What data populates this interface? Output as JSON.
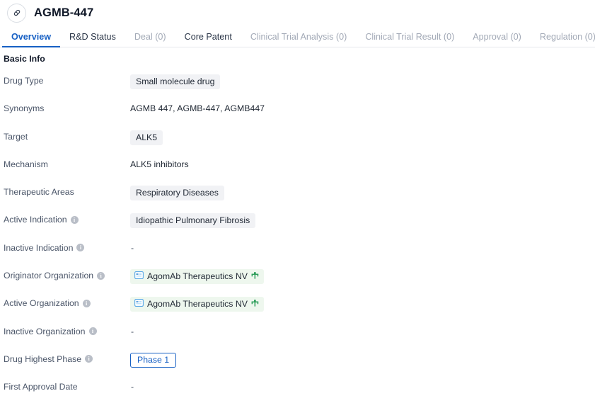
{
  "header": {
    "drug_name": "AGMB-447",
    "avatar_icon": "capsule-pill-icon"
  },
  "tabs": [
    {
      "label": "Overview",
      "state": "active"
    },
    {
      "label": "R&D Status",
      "state": "enabled"
    },
    {
      "label": "Deal (0)",
      "state": "disabled"
    },
    {
      "label": "Core Patent",
      "state": "enabled"
    },
    {
      "label": "Clinical Trial Analysis (0)",
      "state": "disabled"
    },
    {
      "label": "Clinical Trial Result (0)",
      "state": "disabled"
    },
    {
      "label": "Approval (0)",
      "state": "disabled"
    },
    {
      "label": "Regulation (0)",
      "state": "disabled"
    }
  ],
  "section": {
    "title": "Basic Info"
  },
  "rows": [
    {
      "label": "Drug Type",
      "has_info": false,
      "value_type": "chip",
      "value": "Small molecule drug"
    },
    {
      "label": "Synonyms",
      "has_info": false,
      "value_type": "text",
      "value": "AGMB 447,  AGMB-447,  AGMB447"
    },
    {
      "label": "Target",
      "has_info": false,
      "value_type": "chip",
      "value": "ALK5"
    },
    {
      "label": "Mechanism",
      "has_info": false,
      "value_type": "text",
      "value": "ALK5 inhibitors"
    },
    {
      "label": "Therapeutic Areas",
      "has_info": false,
      "value_type": "chip",
      "value": "Respiratory Diseases"
    },
    {
      "label": "Active Indication",
      "has_info": true,
      "value_type": "chip",
      "value": "Idiopathic Pulmonary Fibrosis"
    },
    {
      "label": "Inactive Indication",
      "has_info": true,
      "value_type": "empty",
      "value": "-"
    },
    {
      "label": "Originator Organization",
      "has_info": true,
      "value_type": "org",
      "value": "AgomAb Therapeutics NV"
    },
    {
      "label": "Active Organization",
      "has_info": true,
      "value_type": "org",
      "value": "AgomAb Therapeutics NV"
    },
    {
      "label": "Inactive Organization",
      "has_info": true,
      "value_type": "empty",
      "value": "-"
    },
    {
      "label": "Drug Highest Phase",
      "has_info": true,
      "value_type": "phase",
      "value": "Phase 1"
    },
    {
      "label": "First Approval Date",
      "has_info": false,
      "value_type": "empty",
      "value": "-"
    }
  ],
  "icons": {
    "info": "i",
    "org_badge": "company-badge-icon",
    "org_tree": "org-hierarchy-icon"
  },
  "colors": {
    "accent_blue": "#1760c4",
    "chip_gray": "#f1f2f5",
    "chip_green": "#eef7ee",
    "text_dark": "#1f2733",
    "text_muted": "#a2a9b6"
  }
}
